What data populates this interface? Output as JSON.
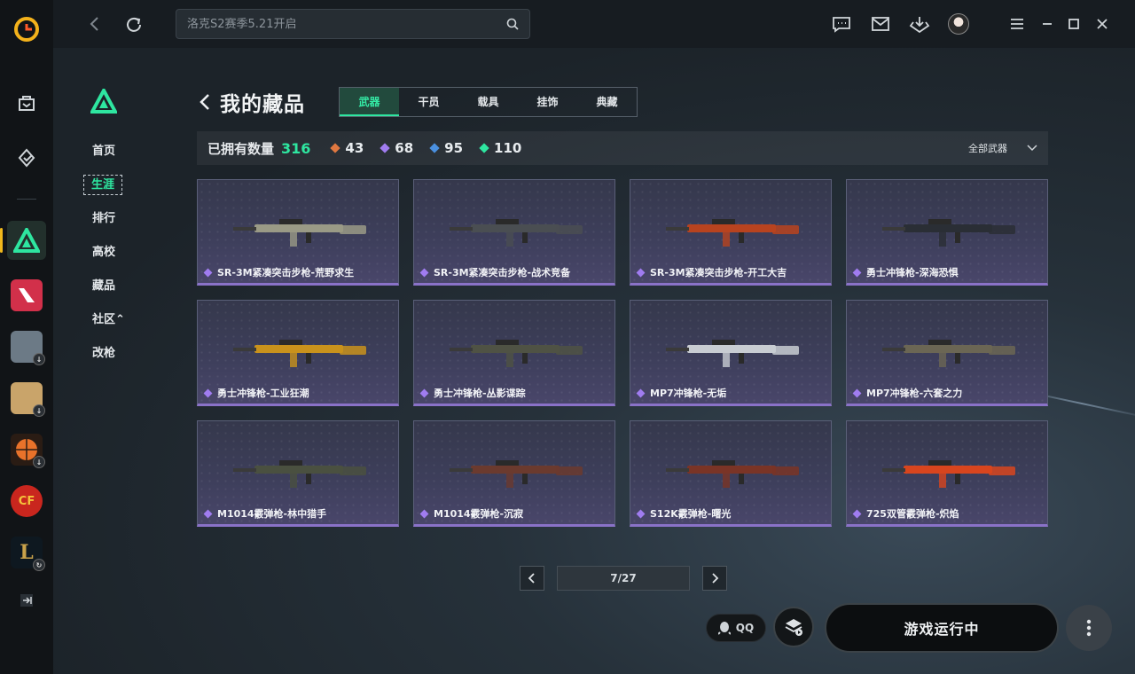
{
  "search": {
    "placeholder": "洛克S2赛季5.21开启"
  },
  "subnav": {
    "items": [
      {
        "label": "首页"
      },
      {
        "label": "生涯"
      },
      {
        "label": "排行"
      },
      {
        "label": "高校"
      },
      {
        "label": "藏品"
      },
      {
        "label": "社区⌃"
      },
      {
        "label": "改枪"
      }
    ]
  },
  "header": {
    "title": "我的藏品"
  },
  "tabs": [
    {
      "label": "武器"
    },
    {
      "label": "干员"
    },
    {
      "label": "载具"
    },
    {
      "label": "挂饰"
    },
    {
      "label": "典藏"
    }
  ],
  "stats": {
    "label": "已拥有数量",
    "total": "316",
    "tiers": [
      {
        "value": "43",
        "color": "#e07840"
      },
      {
        "value": "68",
        "color": "#a07cf0"
      },
      {
        "value": "95",
        "color": "#4a90e0"
      },
      {
        "value": "110",
        "color": "#2ee6a0"
      }
    ],
    "filter": "全部武器"
  },
  "items": [
    {
      "name": "SR-3M紧凑突击步枪-荒野求生",
      "color": "#9a9a86"
    },
    {
      "name": "SR-3M紧凑突击步枪-战术竞备",
      "color": "#4a4e52"
    },
    {
      "name": "SR-3M紧凑突击步枪-开工大吉",
      "color": "#b8431f"
    },
    {
      "name": "勇士冲锋枪-深海恐惧",
      "color": "#2a2e35"
    },
    {
      "name": "勇士冲锋枪-工业狂潮",
      "color": "#c9921c"
    },
    {
      "name": "勇士冲锋枪-丛影谍踪",
      "color": "#4f5244"
    },
    {
      "name": "MP7冲锋枪-无垢",
      "color": "#c8ccd2"
    },
    {
      "name": "MP7冲锋枪-六套之力",
      "color": "#6b6654"
    },
    {
      "name": "M1014霰弹枪-林中猎手",
      "color": "#4a5040"
    },
    {
      "name": "M1014霰弹枪-沉寂",
      "color": "#6b3a2e"
    },
    {
      "name": "S12K霰弹枪-曙光",
      "color": "#7a3426"
    },
    {
      "name": "725双管霰弹枪-炽焰",
      "color": "#d8451e"
    }
  ],
  "pager": {
    "current": "7/27"
  },
  "bottom": {
    "qq_label": "QQ",
    "run_label": "游戏运行中"
  },
  "colors": {
    "accent": "#2ee6a0",
    "rare_purple": "#a07cf0"
  }
}
